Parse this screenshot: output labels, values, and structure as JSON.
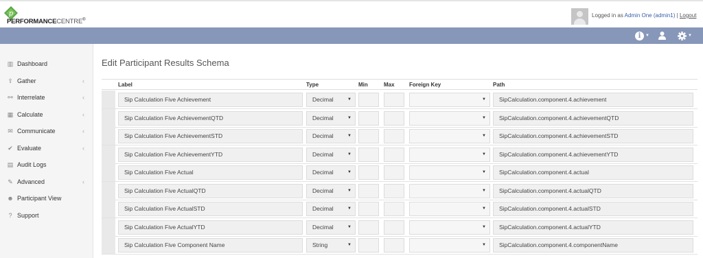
{
  "brand": {
    "bold": "PERFORMANCE",
    "light": "CENTRE",
    "mark": "®",
    "badge_letter": "p"
  },
  "user": {
    "prefix": "Logged in as ",
    "name": "Admin One (admin1)",
    "separator": " | ",
    "logout": "Logout"
  },
  "navbar": {
    "icons": [
      "info-icon",
      "user-icon",
      "gear-icon"
    ],
    "color": "#8797b9"
  },
  "sidebar": {
    "items": [
      {
        "label": "Dashboard",
        "icon": "bar-chart-icon",
        "glyph": "▥",
        "chevron": false
      },
      {
        "label": "Gather",
        "icon": "upload-icon",
        "glyph": "⇪",
        "chevron": true
      },
      {
        "label": "Interrelate",
        "icon": "link-icon",
        "glyph": "⚯",
        "chevron": true
      },
      {
        "label": "Calculate",
        "icon": "table-icon",
        "glyph": "▦",
        "chevron": true
      },
      {
        "label": "Communicate",
        "icon": "comments-icon",
        "glyph": "✉",
        "chevron": true
      },
      {
        "label": "Evaluate",
        "icon": "thumbs-up-icon",
        "glyph": "✔",
        "chevron": true
      },
      {
        "label": "Audit Logs",
        "icon": "file-icon",
        "glyph": "▤",
        "chevron": false
      },
      {
        "label": "Advanced",
        "icon": "wrench-icon",
        "glyph": "✎",
        "chevron": true
      },
      {
        "label": "Participant View",
        "icon": "user-icon",
        "glyph": "☻",
        "chevron": false
      },
      {
        "label": "Support",
        "icon": "question-icon",
        "glyph": "?",
        "chevron": false
      }
    ]
  },
  "main": {
    "title": "Edit Participant Results Schema",
    "columns": {
      "label": "Label",
      "type": "Type",
      "min": "Min",
      "max": "Max",
      "foreign_key": "Foreign Key",
      "path": "Path"
    },
    "rows": [
      {
        "label": "Sip Calculation Five Achievement",
        "type": "Decimal",
        "min": "",
        "max": "",
        "foreign_key": "",
        "path": "SipCalculation.component.4.achievement"
      },
      {
        "label": "Sip Calculation Five AchievementQTD",
        "type": "Decimal",
        "min": "",
        "max": "",
        "foreign_key": "",
        "path": "SipCalculation.component.4.achievementQTD"
      },
      {
        "label": "Sip Calculation Five AchievementSTD",
        "type": "Decimal",
        "min": "",
        "max": "",
        "foreign_key": "",
        "path": "SipCalculation.component.4.achievementSTD"
      },
      {
        "label": "Sip Calculation Five AchievementYTD",
        "type": "Decimal",
        "min": "",
        "max": "",
        "foreign_key": "",
        "path": "SipCalculation.component.4.achievementYTD"
      },
      {
        "label": "Sip Calculation Five Actual",
        "type": "Decimal",
        "min": "",
        "max": "",
        "foreign_key": "",
        "path": "SipCalculation.component.4.actual"
      },
      {
        "label": "Sip Calculation Five ActualQTD",
        "type": "Decimal",
        "min": "",
        "max": "",
        "foreign_key": "",
        "path": "SipCalculation.component.4.actualQTD"
      },
      {
        "label": "Sip Calculation Five ActualSTD",
        "type": "Decimal",
        "min": "",
        "max": "",
        "foreign_key": "",
        "path": "SipCalculation.component.4.actualSTD"
      },
      {
        "label": "Sip Calculation Five ActualYTD",
        "type": "Decimal",
        "min": "",
        "max": "",
        "foreign_key": "",
        "path": "SipCalculation.component.4.actualYTD"
      },
      {
        "label": "Sip Calculation Five Component Name",
        "type": "String",
        "min": "",
        "max": "",
        "foreign_key": "",
        "path": "SipCalculation.component.4.componentName"
      }
    ]
  }
}
